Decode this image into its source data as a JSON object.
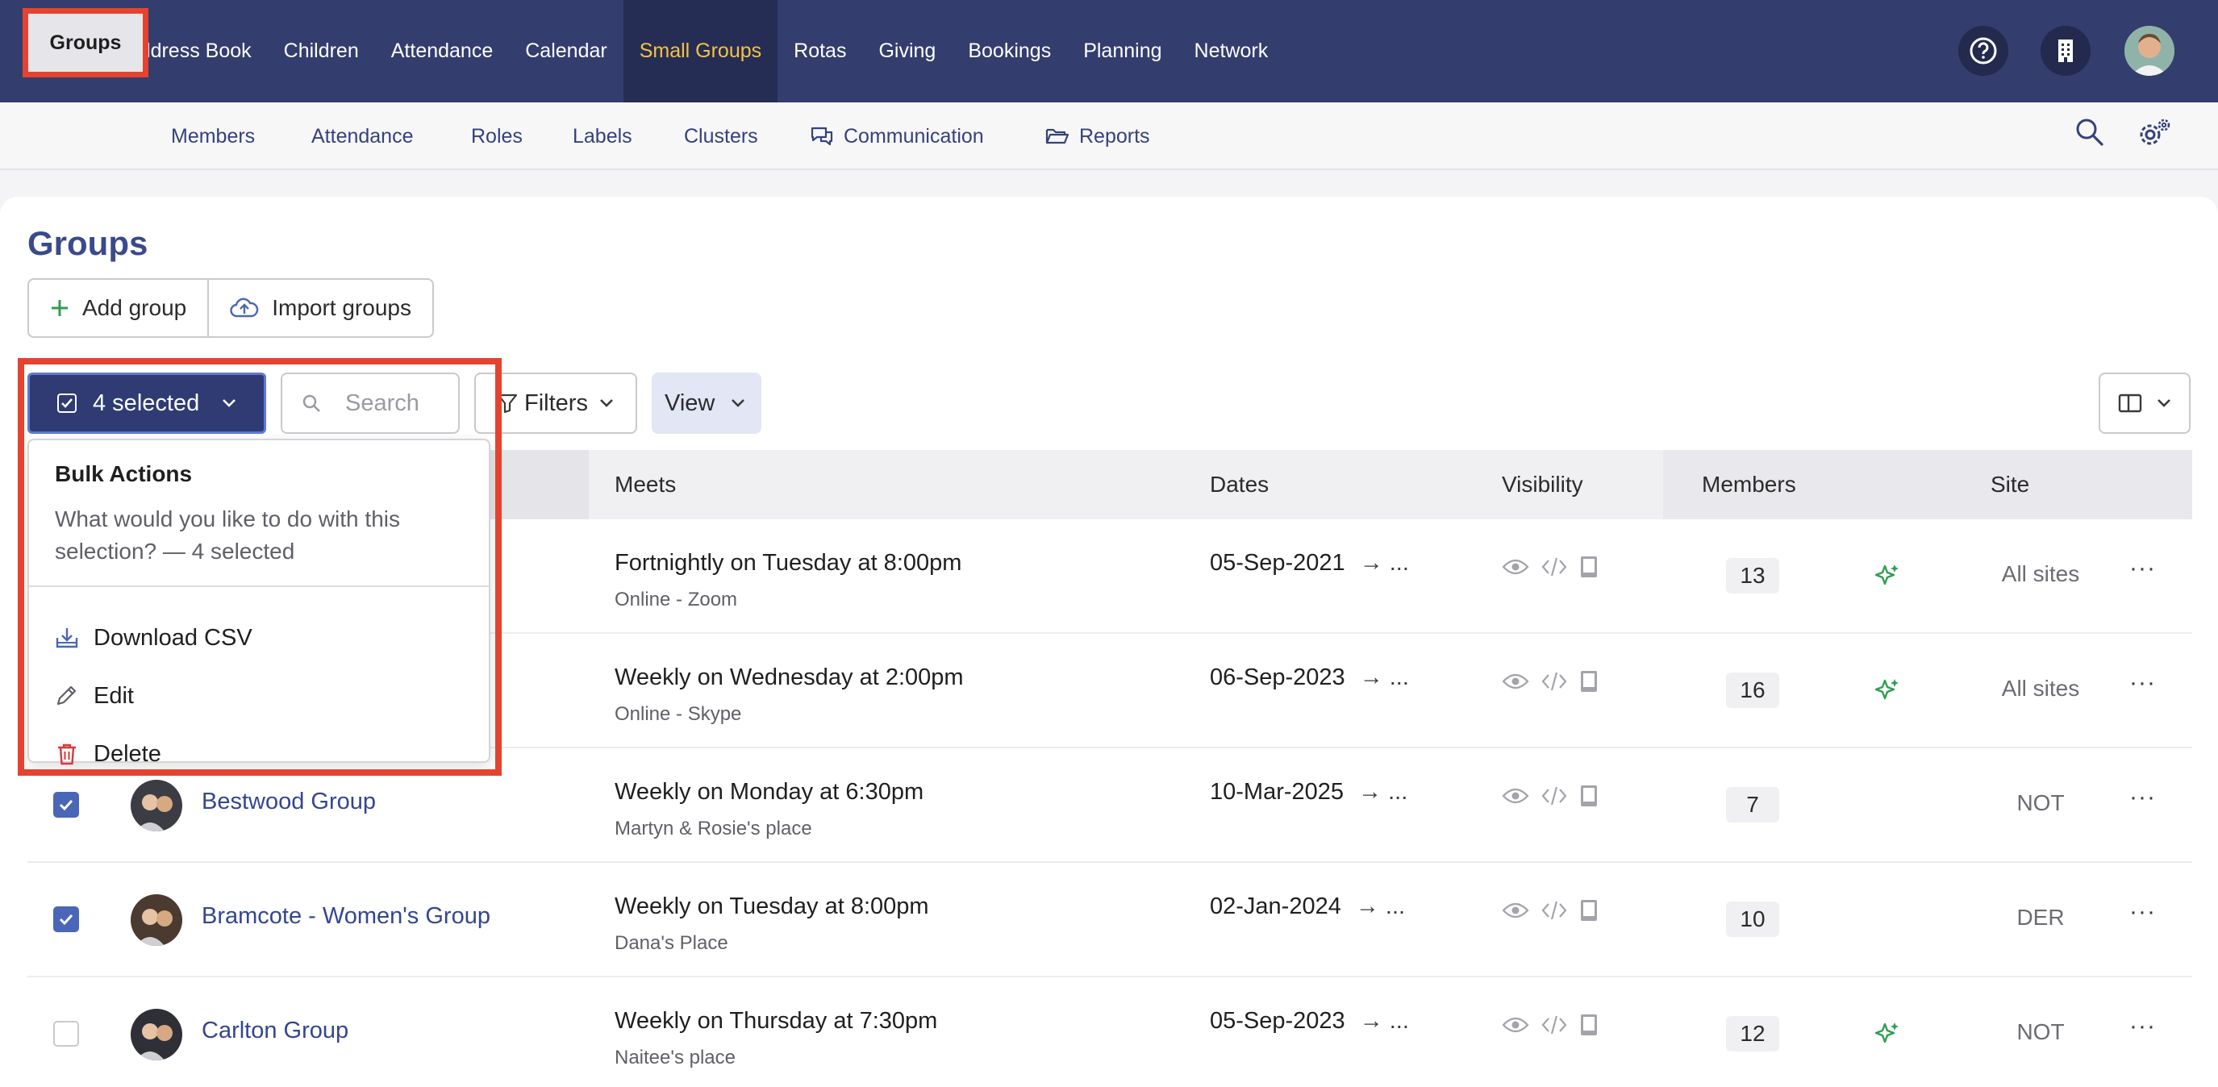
{
  "top_nav": {
    "items": [
      "Address Book",
      "Children",
      "Attendance",
      "Calendar",
      "Small Groups",
      "Rotas",
      "Giving",
      "Bookings",
      "Planning",
      "Network"
    ],
    "active": "Small Groups",
    "icons": [
      "help-icon",
      "building-icon",
      "user-avatar"
    ]
  },
  "sub_nav": {
    "items": [
      "Groups",
      "Members",
      "Attendance",
      "Roles",
      "Labels",
      "Clusters",
      "Communication",
      "Reports"
    ],
    "active": "Groups",
    "icons": [
      "search-icon",
      "settings-icon"
    ]
  },
  "page": {
    "title": "Groups",
    "add_group": "Add group",
    "import_groups": "Import groups"
  },
  "toolbar": {
    "selected_label": "4 selected",
    "search_placeholder": "Search",
    "filters_label": "Filters",
    "view_label": "View"
  },
  "dropdown": {
    "title": "Bulk Actions",
    "description": "What would you like to do with this selection? — 4 selected",
    "items": [
      "Download CSV",
      "Edit",
      "Delete"
    ]
  },
  "table": {
    "headers": [
      "Meets",
      "Dates",
      "Visibility",
      "Members",
      "Site"
    ],
    "rows": [
      {
        "name": "",
        "meets": "Fortnightly on Tuesday at 8:00pm",
        "location": "Online - Zoom",
        "dates": "05-Sep-2021",
        "members": "13",
        "site": "All sites",
        "checked": true,
        "sparkle": true
      },
      {
        "name": "",
        "meets": "Weekly on Wednesday at 2:00pm",
        "location": "Online - Skype",
        "dates": "06-Sep-2023",
        "members": "16",
        "site": "All sites",
        "checked": true,
        "sparkle": true
      },
      {
        "name": "Bestwood Group",
        "meets": "Weekly on Monday at 6:30pm",
        "location": "Martyn & Rosie's place",
        "dates": "10-Mar-2025",
        "members": "7",
        "site": "NOT",
        "checked": true,
        "sparkle": false
      },
      {
        "name": "Bramcote - Women's Group",
        "meets": "Weekly on Tuesday at 8:00pm",
        "location": "Dana's Place",
        "dates": "02-Jan-2024",
        "members": "10",
        "site": "DER",
        "checked": true,
        "sparkle": false
      },
      {
        "name": "Carlton Group",
        "meets": "Weekly on Thursday at 7:30pm",
        "location": "Naitee's place",
        "dates": "05-Sep-2023",
        "members": "12",
        "site": "NOT",
        "checked": false,
        "sparkle": true
      }
    ],
    "date_suffix": "→  ...",
    "more_label": "···"
  },
  "colors": {
    "nav_bg": "#333d6e",
    "active_nav": "#f5c242",
    "link": "#34468f",
    "highlight": "#e4442f",
    "sparkle": "#2e9e50",
    "delete": "#d9393a"
  }
}
